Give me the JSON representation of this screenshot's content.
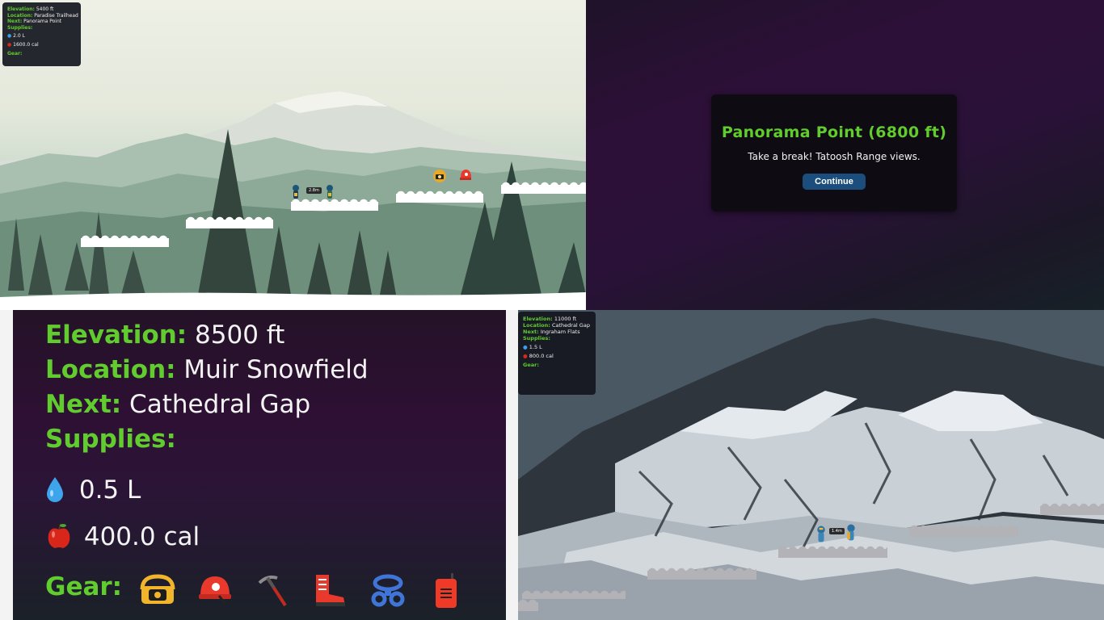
{
  "scene1": {
    "hud": {
      "elevation_label": "Elevation:",
      "elevation_value": "5400 ft",
      "location_label": "Location:",
      "location_value": "Paradise Trailhead",
      "next_label": "Next:",
      "next_value": "Panorama Point",
      "supplies_label": "Supplies:",
      "water": "2.0 L",
      "food": "1600.0 cal",
      "gear_label": "Gear:"
    },
    "distance_tag": "2.8m"
  },
  "dialog": {
    "title": "Panorama Point (6800 ft)",
    "message": "Take a break! Tatoosh Range views.",
    "button": "Continue"
  },
  "hud_zoom": {
    "elevation_label": "Elevation:",
    "elevation_value": "8500 ft",
    "location_label": "Location:",
    "location_value": "Muir Snowfield",
    "next_label": "Next:",
    "next_value": "Cathedral Gap",
    "supplies_label": "Supplies:",
    "water": "0.5 L",
    "food": "400.0 cal",
    "gear_label": "Gear:",
    "gear_items": [
      "headlamp-icon",
      "helmet-icon",
      "ice-axe-icon",
      "boots-icon",
      "harness-icon",
      "radio-icon"
    ]
  },
  "scene2": {
    "hud": {
      "elevation_label": "Elevation:",
      "elevation_value": "11000 ft",
      "location_label": "Location:",
      "location_value": "Cathedral Gap",
      "next_label": "Next:",
      "next_value": "Ingraham Flats",
      "supplies_label": "Supplies:",
      "water": "1.5 L",
      "food": "800.0 cal",
      "gear_label": "Gear:"
    },
    "distance_tag": "1.4m"
  },
  "colors": {
    "accent_green": "#61cc2e",
    "button_blue": "#1b4e7c",
    "panel_purple": "#2e1034"
  }
}
